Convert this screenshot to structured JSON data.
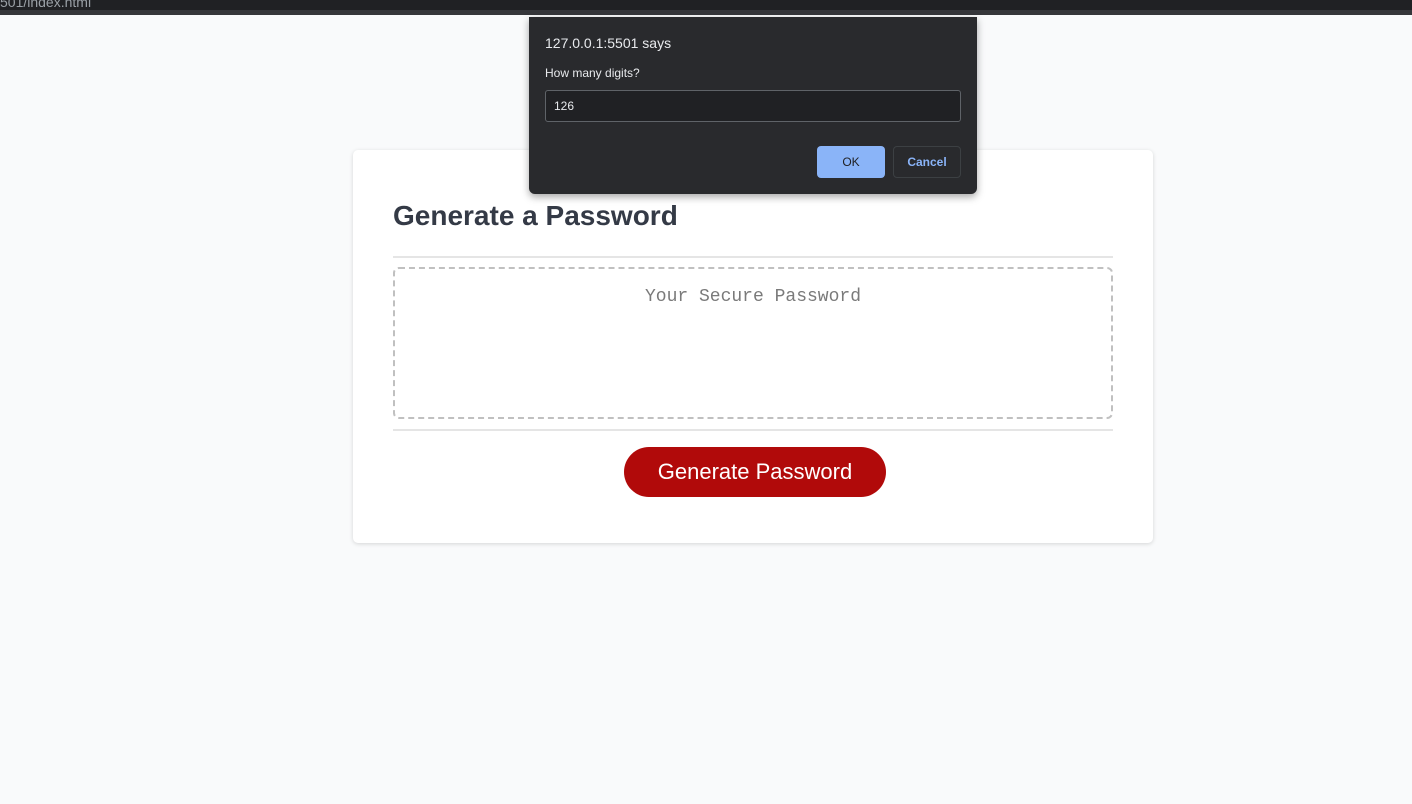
{
  "browser": {
    "address_text": "501/index.html"
  },
  "card": {
    "title": "Generate a Password",
    "password_placeholder": "Your Secure Password",
    "generate_label": "Generate Password"
  },
  "dialog": {
    "origin": "127.0.0.1:5501 says",
    "message": "How many digits?",
    "input_value": "126",
    "ok_label": "OK",
    "cancel_label": "Cancel"
  },
  "colors": {
    "accent_button": "#b10a0a",
    "dialog_primary": "#8ab4f8",
    "dialog_background": "#292a2d"
  }
}
